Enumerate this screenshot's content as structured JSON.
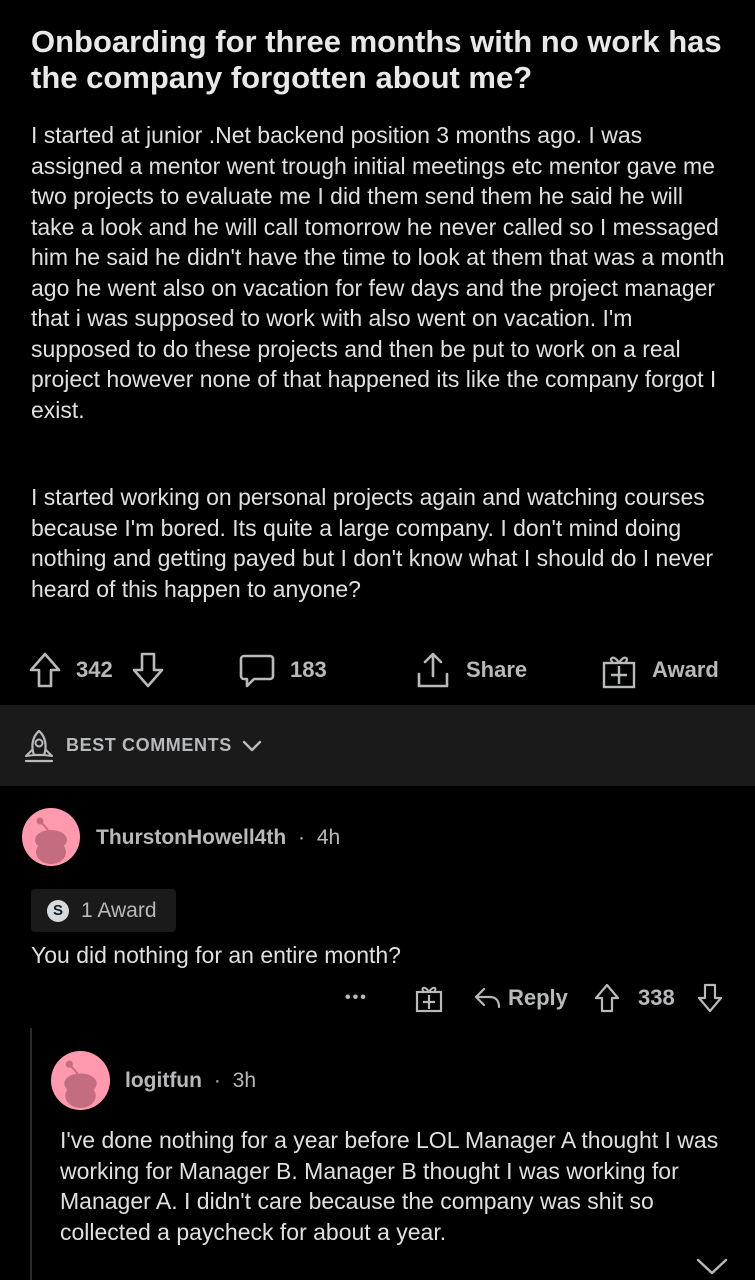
{
  "post": {
    "title": "Onboarding for three months with no work has the company forgotten about me?",
    "body_p1": "I started at junior .Net backend position 3 months ago. I was assigned a mentor went trough initial meetings etc mentor gave me two projects to evaluate me I did them send them he said he will take a look and he will call tomorrow he never called so I messaged him he said he didn't have the time to look at them that was a month ago he went also on vacation for few days and the project manager that i was supposed to work with also went on vacation. I'm supposed to do these projects and then be put to work on a real project however none of that happened its like the company forgot I exist.",
    "body_p2": "I started working on personal projects again and watching courses because I'm bored. Its quite a large company. I don't mind doing nothing and getting payed but I don't know what I should do I never heard of this happen to anyone?"
  },
  "actions": {
    "upvotes": "342",
    "comments": "183",
    "share_label": "Share",
    "award_label": "Award"
  },
  "sort": {
    "label": "BEST COMMENTS"
  },
  "comments": [
    {
      "username": "ThurstonHowell4th",
      "dot": "·",
      "time": "4h",
      "awards": "1 Award",
      "award_coin": "S",
      "text": "You did nothing for an entire month?",
      "more": "•••",
      "reply_label": "Reply",
      "score": "338"
    },
    {
      "username": "logitfun",
      "dot": "·",
      "time": "3h",
      "text": "I've done nothing for a year before LOL Manager A thought I was working for Manager B. Manager B thought I was working for Manager A. I didn't care because the company was shit so collected a paycheck for about a year."
    }
  ],
  "colors": {
    "background": "#000000",
    "panel": "#1a1a1b",
    "text": "#e0e0e0",
    "muted": "#b7b9bb",
    "avatar": "#ff9aae"
  }
}
